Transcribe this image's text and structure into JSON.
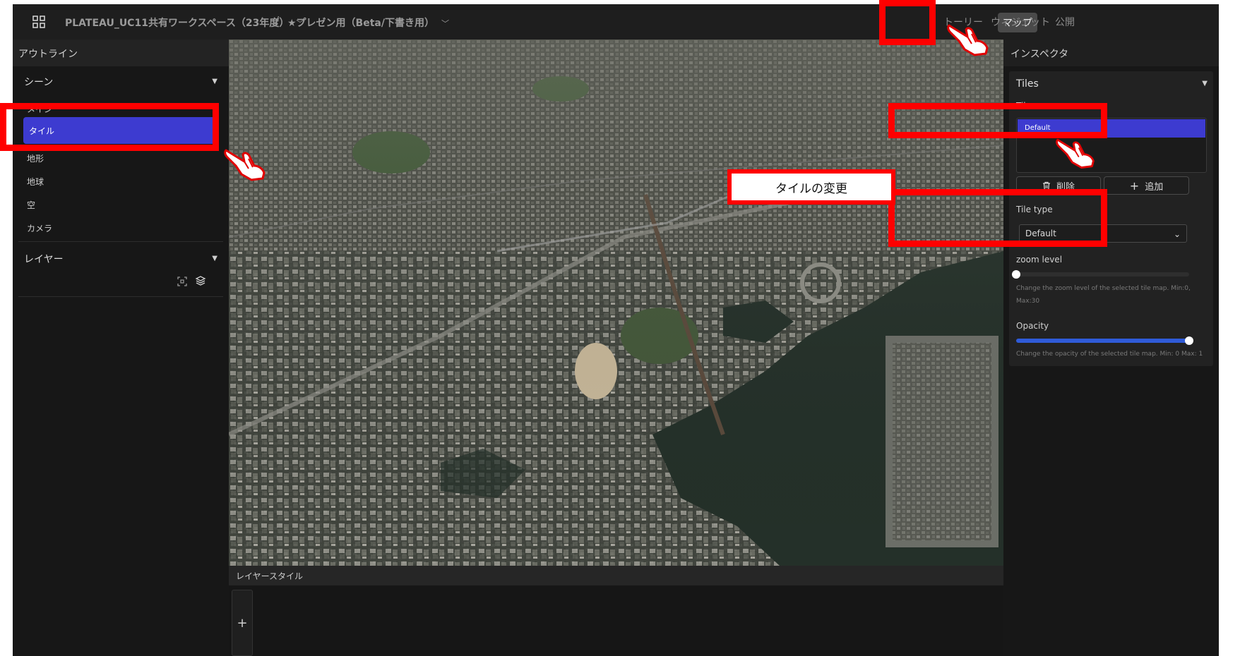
{
  "header": {
    "workspace": "PLATEAU_UC11共有ワークスペース（23年度）",
    "separator": "/",
    "project": "★プレゼン用（Beta/下書き用）",
    "tabs": {
      "map": "マップ",
      "story": "トーリー",
      "widget": "ウィジェット",
      "publish": "公開"
    }
  },
  "outline": {
    "title": "アウトライン",
    "scene_label": "シーン",
    "scene_items": [
      "メイン",
      "タイル",
      "地形",
      "地球",
      "空",
      "カメラ"
    ],
    "selected_item": "タイル",
    "layer_label": "レイヤー"
  },
  "layer_style": {
    "title": "レイヤースタイル",
    "add": "+"
  },
  "inspector": {
    "title": "インスペクタ",
    "card_title": "Tiles",
    "tiles_label": "Tiles",
    "tiles_list": [
      "Default"
    ],
    "delete_button": "削除",
    "add_button": "追加",
    "tile_type_label": "Tile type",
    "tile_type_value": "Default",
    "zoom_label": "zoom level",
    "zoom_value": 0,
    "zoom_desc": "Change the zoom level of the selected tile map. Min:0, Max:30",
    "opacity_label": "Opacity",
    "opacity_value": 1,
    "opacity_desc": "Change the opacity of the selected tile map. Min: 0 Max: 1"
  },
  "annotation": {
    "callout": "タイルの変更"
  },
  "colors": {
    "accent": "#3d3bd0",
    "highlight": "#ff0000",
    "slider": "#2f5bd9"
  }
}
